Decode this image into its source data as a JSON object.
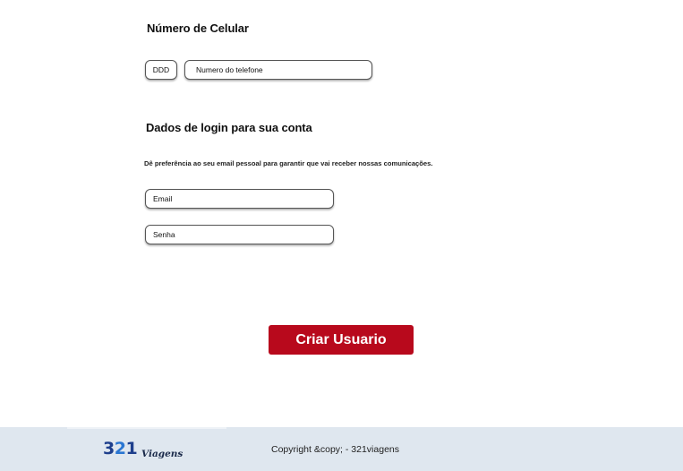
{
  "phone_section": {
    "title": "Número de Celular",
    "ddd_placeholder": "DDD",
    "phone_placeholder": "Numero do telefone"
  },
  "login_section": {
    "title": "Dados de login para sua conta",
    "hint": "Dê preferência ao seu email pessoal para garantir que vai receber nossas comunicações.",
    "email_placeholder": "Email",
    "password_placeholder": "Senha"
  },
  "actions": {
    "create_user_label": "Criar Usuario"
  },
  "footer": {
    "logo": {
      "digit_1": "3",
      "digit_2": "2",
      "digit_3": "1",
      "word": "Viagens"
    },
    "copyright": "Copyright &copy; - 321viagens"
  },
  "colors": {
    "primary_button": "#b8091c",
    "footer_background": "#dfe7ef",
    "logo_dark_blue": "#1e3f8c",
    "logo_light_blue": "#2a76d2"
  }
}
